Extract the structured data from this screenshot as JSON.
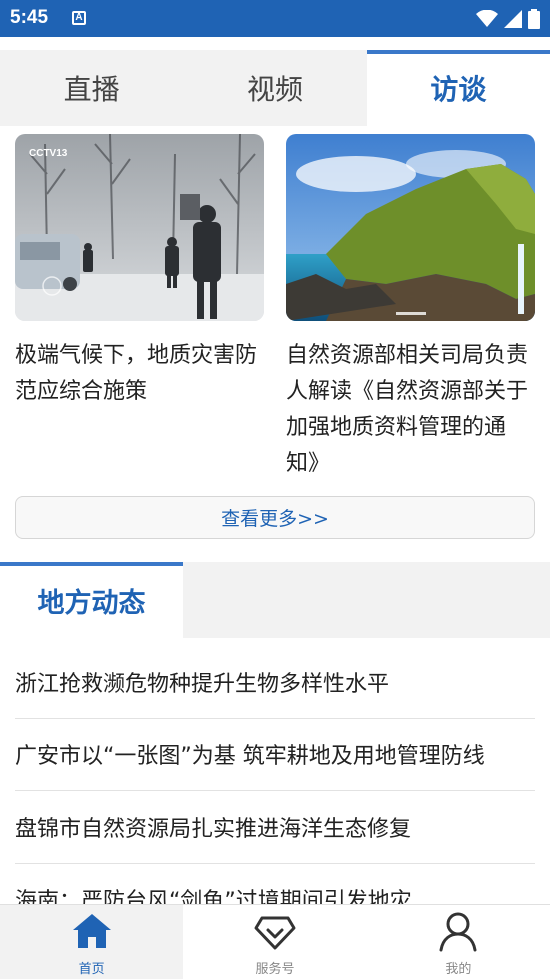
{
  "status_bar": {
    "time": "5:45",
    "notification_letter": "A"
  },
  "tabs": [
    {
      "label": "直播",
      "active": false
    },
    {
      "label": "视频",
      "active": false
    },
    {
      "label": "访谈",
      "active": true
    }
  ],
  "videos": [
    {
      "title": "极端气候下，地质灾害防范应综合施策",
      "thumb_icon": "snowy-street-thumbnail",
      "watermark": "CCTV13"
    },
    {
      "title": "自然资源部相关司局负责人解读《自然资源部关于加强地质资料管理的通知》",
      "thumb_icon": "coastal-cliff-thumbnail"
    }
  ],
  "more_button": "查看更多>>",
  "section": {
    "title": "地方动态"
  },
  "news": [
    "浙江抢救濒危物种提升生物多样性水平",
    "广安市以“一张图”为基 筑牢耕地及用地管理防线",
    "盘锦市自然资源局扎实推进海洋生态修复",
    "海南：严防台风“剑鱼”过境期间引发地灾"
  ],
  "bottom_nav": [
    {
      "label": "首页",
      "icon": "home-icon",
      "active": true
    },
    {
      "label": "服务号",
      "icon": "diamond-heart-icon",
      "active": false
    },
    {
      "label": "我的",
      "icon": "person-icon",
      "active": false
    }
  ],
  "colors": {
    "brand": "#1f63b4",
    "accent_line": "#3a78c9"
  }
}
